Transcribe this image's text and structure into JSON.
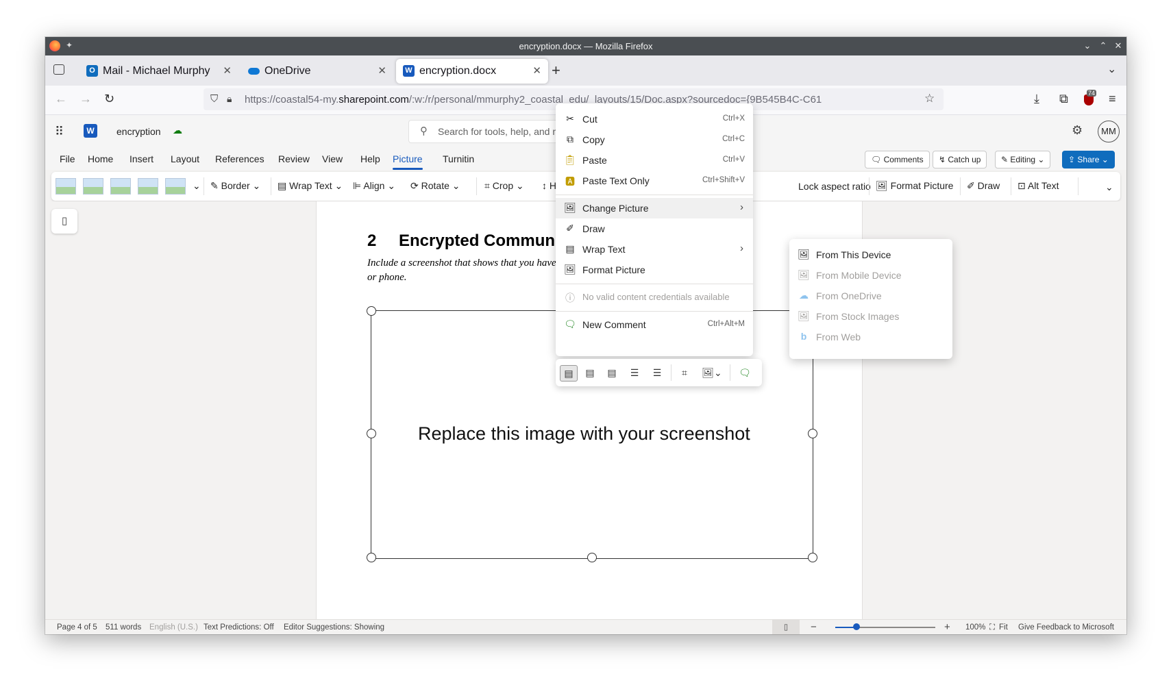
{
  "window": {
    "title": "encryption.docx — Mozilla Firefox"
  },
  "tabs": [
    {
      "label": "Mail - Michael Murphy",
      "icon": "outlook-icon"
    },
    {
      "label": "OneDrive",
      "icon": "onedrive-icon"
    },
    {
      "label": "encryption.docx",
      "icon": "word-icon"
    }
  ],
  "navbar": {
    "url_prefix": "https://coastal54-my.",
    "url_domain": "sharepoint.com",
    "url_suffix": "/:w:/r/personal/mmurphy2_coastal_edu/_layouts/15/Doc.aspx?sourcedoc={9B545B4C-C61",
    "extension_badge": "74"
  },
  "app": {
    "doc_name": "encryption",
    "search_placeholder": "Search for tools, help, and more (Alt + Q)",
    "avatar": "MM"
  },
  "ribbon_tabs": [
    "File",
    "Home",
    "Insert",
    "Layout",
    "References",
    "Review",
    "View",
    "Help",
    "Picture",
    "Turnitin"
  ],
  "header_buttons": {
    "comments": "Comments",
    "catchup": "Catch up",
    "editing": "Editing",
    "share": "Share"
  },
  "ribbon": {
    "border": "Border",
    "wrap_text": "Wrap Text",
    "align": "Align",
    "rotate": "Rotate",
    "crop": "Crop",
    "height": "Height",
    "lock_aspect": "Lock aspect ratio",
    "format_picture": "Format Picture",
    "draw": "Draw",
    "alt_text": "Alt Text"
  },
  "document": {
    "heading_number": "2",
    "heading_text": "Encrypted Communicatio",
    "instruction_line1": "Include a screenshot that shows that you have instal",
    "instruction_line2": "or phone.",
    "placeholder_text": "Replace this image with your screenshot"
  },
  "context_menu": {
    "cut": {
      "label": "Cut",
      "shortcut": "Ctrl+X"
    },
    "copy": {
      "label": "Copy",
      "shortcut": "Ctrl+C"
    },
    "paste": {
      "label": "Paste",
      "shortcut": "Ctrl+V"
    },
    "paste_text": {
      "label": "Paste Text Only",
      "shortcut": "Ctrl+Shift+V"
    },
    "change_picture": {
      "label": "Change Picture"
    },
    "draw": {
      "label": "Draw"
    },
    "wrap_text": {
      "label": "Wrap Text"
    },
    "format_picture": {
      "label": "Format Picture"
    },
    "credentials": {
      "label": "No valid content credentials available"
    },
    "new_comment": {
      "label": "New Comment",
      "shortcut": "Ctrl+Alt+M"
    }
  },
  "submenu": {
    "from_device": "From This Device",
    "from_mobile": "From Mobile Device",
    "from_onedrive": "From OneDrive",
    "from_stock": "From Stock Images",
    "from_web": "From Web"
  },
  "statusbar": {
    "page": "Page 4 of 5",
    "words": "511 words",
    "language": "English (U.S.)",
    "predictions": "Text Predictions: Off",
    "editor": "Editor Suggestions: Showing",
    "zoom": "100%",
    "fit": "Fit",
    "feedback": "Give Feedback to Microsoft"
  },
  "colors": {
    "accent": "#185abd",
    "share_bg": "#0f6cbd",
    "titlebar": "#4a4e52"
  }
}
